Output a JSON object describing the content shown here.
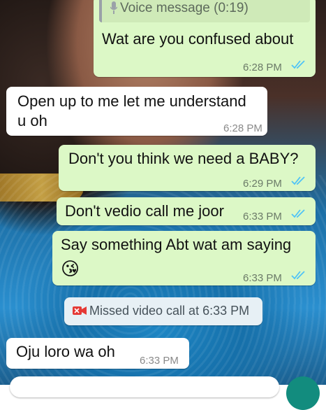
{
  "messages": [
    {
      "direction": "outgoing",
      "quoted": {
        "type": "voice",
        "label": "Voice message (0:19)"
      },
      "text": "Wat are you confused about",
      "time": "6:28 PM",
      "status": "read"
    },
    {
      "direction": "incoming",
      "text_lines": [
        "Open up to me let me understand",
        "u oh"
      ],
      "time": "6:28 PM"
    },
    {
      "direction": "outgoing",
      "text": "Don't you think we need a BABY?",
      "time": "6:29 PM",
      "status": "read"
    },
    {
      "direction": "outgoing",
      "text": "Don't vedio call me joor",
      "time": "6:33 PM",
      "status": "read"
    },
    {
      "direction": "outgoing",
      "text": "Say something Abt wat am saying",
      "emoji": "😘",
      "time": "6:33 PM",
      "status": "read"
    },
    {
      "direction": "incoming",
      "text": "Oju loro wa oh",
      "time": "6:33 PM"
    }
  ],
  "system_event": {
    "icon": "missed-video-call-icon",
    "text": "Missed video call at 6:33 PM"
  },
  "colors": {
    "outgoing_bubble": "#dcf8c6",
    "incoming_bubble": "#ffffff",
    "read_ticks": "#4fc3f7",
    "missed_call": "#e53935",
    "fab": "#128c7e"
  }
}
